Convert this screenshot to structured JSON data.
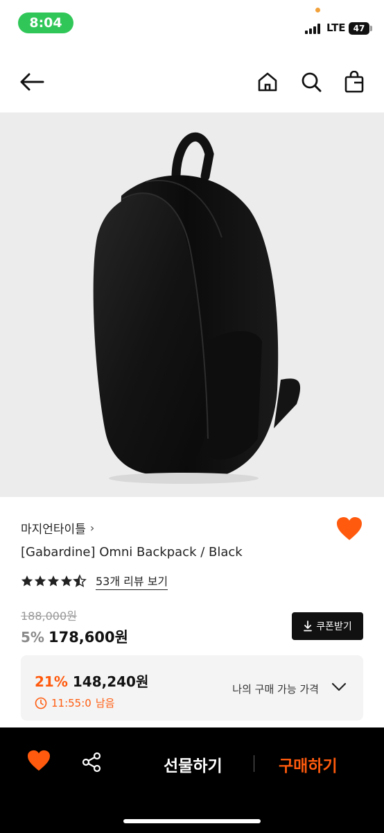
{
  "status_bar": {
    "time": "8:04",
    "network": "LTE",
    "battery": "47"
  },
  "nav": {
    "icons": [
      "back-arrow-icon",
      "home-icon",
      "search-icon",
      "shopping-bag-icon"
    ]
  },
  "product": {
    "brand": "마지언타이틀",
    "brand_chevron": "›",
    "title": "[Gabardine] Omni Backpack / Black",
    "rating": 4.5,
    "review_link": "53개 리뷰 보기",
    "original_price": "188,000원",
    "discount_rate": "5%",
    "sale_price": "178,600원",
    "coupon_button": "쿠폰받기"
  },
  "my_price": {
    "rate": "21%",
    "price": "148,240원",
    "timer_value": "11:55:0",
    "timer_suffix": "남음",
    "label": "나의 구매 가능 가격"
  },
  "bottom_bar": {
    "gift_label": "선물하기",
    "buy_label": "구매하기"
  },
  "colors": {
    "accent": "#ff5a0d",
    "status_green": "#30c758",
    "bottom_bar": "#000000"
  }
}
